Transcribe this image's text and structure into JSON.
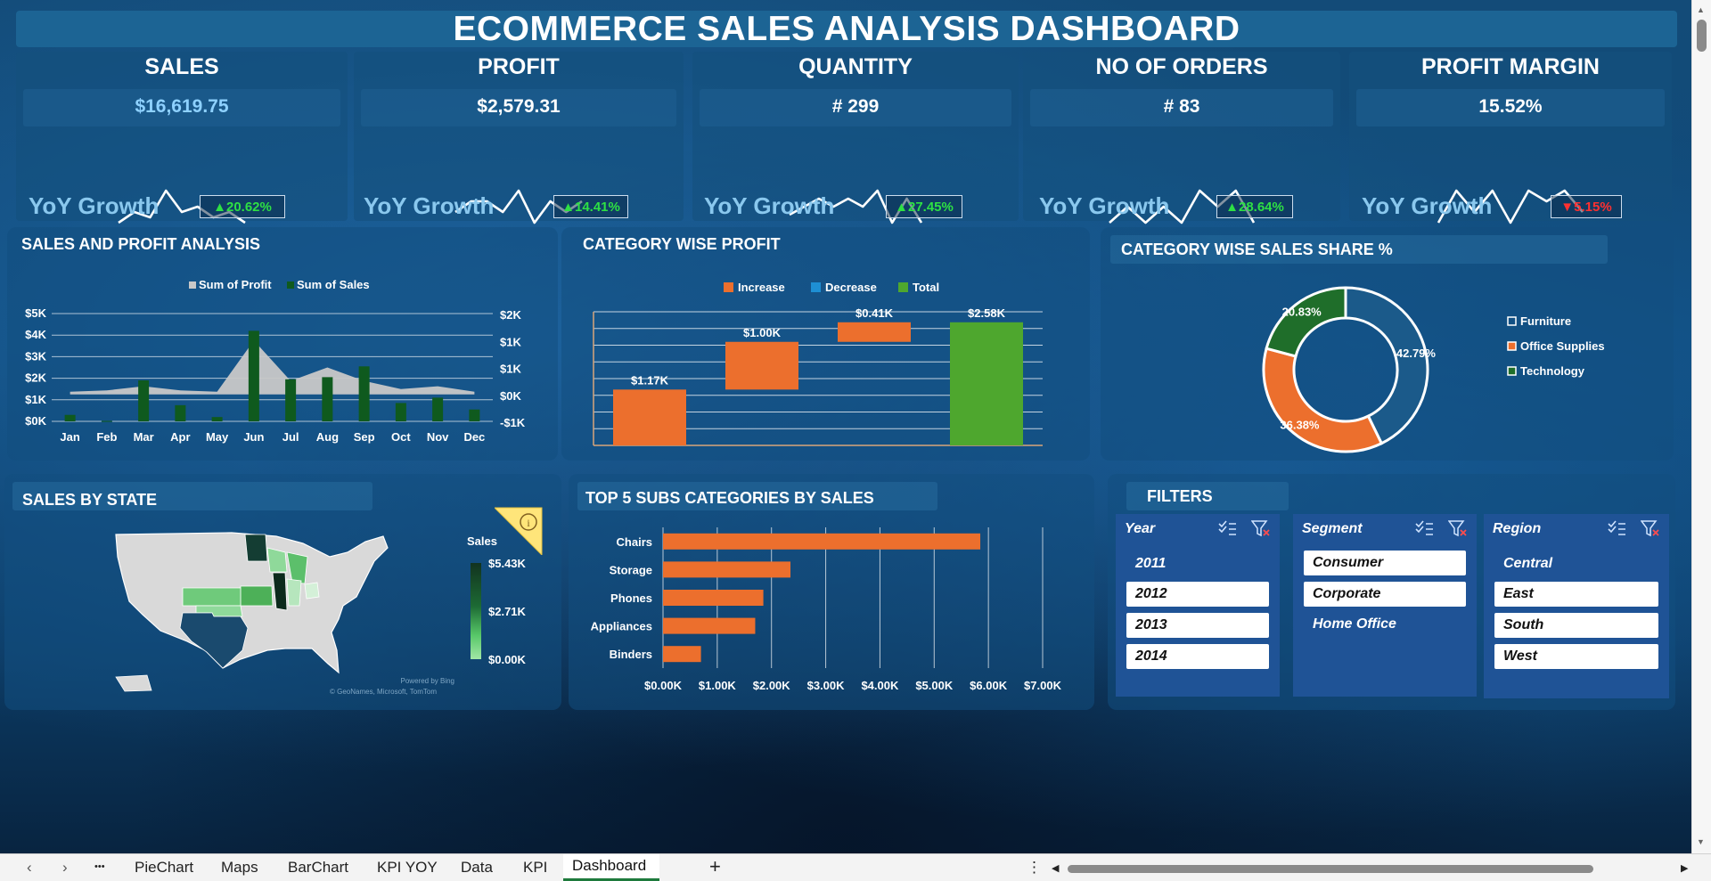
{
  "title": "ECOMMERCE SALES ANALYSIS DASHBOARD",
  "kpis": [
    {
      "title": "SALES",
      "value": "$16,619.75",
      "yoy_label": "YoY Growth",
      "yoy_value": "▲20.62%",
      "trend": "up",
      "spark": [
        3,
        5,
        4,
        9,
        5,
        6,
        4,
        5,
        3
      ]
    },
    {
      "title": "PROFIT",
      "value": "$2,579.31",
      "yoy_label": "YoY Growth",
      "yoy_value": "▲14.41%",
      "trend": "up",
      "spark": [
        4,
        5,
        5,
        4,
        6,
        3,
        5,
        4,
        5
      ]
    },
    {
      "title": "QUANTITY",
      "value": "# 299",
      "yoy_label": "YoY Growth",
      "yoy_value": "▲27.45%",
      "trend": "up",
      "spark": [
        3,
        4,
        5,
        4,
        5,
        4,
        6,
        2,
        5,
        2
      ]
    },
    {
      "title": "NO OF ORDERS",
      "value": "# 83",
      "yoy_label": "YoY Growth",
      "yoy_value": "▲28.64%",
      "trend": "up",
      "spark": [
        3,
        4,
        3,
        4,
        3,
        5,
        4,
        5,
        3
      ]
    },
    {
      "title": "PROFIT MARGIN",
      "value": "15.52%",
      "yoy_label": "YoY Growth",
      "yoy_value": "▼5.15%",
      "trend": "down",
      "spark": [
        3,
        6,
        4,
        6,
        3,
        6,
        5,
        6,
        4
      ]
    }
  ],
  "sections": {
    "sales_profit": "SALES AND PROFIT ANALYSIS",
    "category_profit": "CATEGORY WISE PROFIT",
    "category_share": "CATEGORY WISE SALES SHARE %",
    "sales_state": "SALES  BY STATE",
    "top5": "TOP 5 SUBS CATEGORIES BY SALES",
    "filters": "FILTERS"
  },
  "chart_data": [
    {
      "type": "bar",
      "title": "SALES AND PROFIT ANALYSIS",
      "categories": [
        "Jan",
        "Feb",
        "Mar",
        "Apr",
        "May",
        "Jun",
        "Jul",
        "Aug",
        "Sep",
        "Oct",
        "Nov",
        "Dec"
      ],
      "series": [
        {
          "name": "Sum of Profit",
          "kind": "area",
          "axis": "right",
          "values": [
            0.1,
            0.15,
            0.3,
            0.15,
            0.1,
            2.0,
            0.5,
            1.0,
            0.5,
            0.2,
            0.3,
            0.1
          ],
          "color": "#c8c8c8"
        },
        {
          "name": "Sum of Sales",
          "kind": "column",
          "axis": "left",
          "values": [
            0.3,
            0.02,
            1.9,
            0.75,
            0.2,
            4.2,
            1.95,
            2.05,
            2.55,
            0.85,
            1.1,
            0.55
          ],
          "color": "#0f5a1e"
        }
      ],
      "left_ticks": [
        "$0K",
        "$1K",
        "$2K",
        "$3K",
        "$4K",
        "$5K"
      ],
      "right_ticks": [
        "-$1K",
        "$0K",
        "$1K",
        "$1K",
        "$2K"
      ],
      "ylim_left": [
        0,
        5
      ],
      "ylim_right": [
        -1,
        3
      ],
      "legend": "top"
    },
    {
      "type": "bar",
      "title": "CATEGORY WISE PROFIT",
      "waterfall": [
        {
          "label": "$1.17K",
          "start": 0,
          "end": 1.17,
          "kind": "Increase"
        },
        {
          "label": "$1.00K",
          "start": 1.17,
          "end": 2.17,
          "kind": "Increase"
        },
        {
          "label": "$0.41K",
          "start": 2.17,
          "end": 2.58,
          "kind": "Increase"
        },
        {
          "label": "$2.58K",
          "start": 0,
          "end": 2.58,
          "kind": "Total"
        }
      ],
      "legend_items": [
        {
          "name": "Increase",
          "color": "#ec6f2d"
        },
        {
          "name": "Decrease",
          "color": "#1e8fd4"
        },
        {
          "name": "Total",
          "color": "#4ea72e"
        }
      ],
      "ylim": [
        0,
        2.8
      ]
    },
    {
      "type": "pie",
      "title": "CATEGORY WISE SALES SHARE %",
      "donut": true,
      "slices": [
        {
          "name": "Furniture",
          "value": 42.79,
          "label": "42.79%",
          "color": "#1b5a8a"
        },
        {
          "name": "Office Supplies",
          "value": 36.38,
          "label": "36.38%",
          "color": "#ec6f2d"
        },
        {
          "name": "Technology",
          "value": 20.83,
          "label": "20.83%",
          "color": "#1f6e2a"
        }
      ],
      "legend": "right"
    },
    {
      "type": "bar",
      "orientation": "horizontal",
      "title": "TOP 5 SUBS CATEGORIES BY SALES",
      "categories": [
        "Chairs",
        "Storage",
        "Phones",
        "Appliances",
        "Binders"
      ],
      "values": [
        5.85,
        2.35,
        1.85,
        1.7,
        0.7
      ],
      "x_ticks": [
        "$0.00K",
        "$1.00K",
        "$2.00K",
        "$3.00K",
        "$4.00K",
        "$5.00K",
        "$6.00K",
        "$7.00K"
      ],
      "xlim": [
        0,
        7
      ],
      "color": "#ec6f2d"
    }
  ],
  "map": {
    "legend_title": "Sales",
    "legend_max": "$5.43K",
    "legend_mid": "$2.71K",
    "legend_min": "$0.00K",
    "attribution_1": "Powered by Bing",
    "attribution_2": "© GeoNames, Microsoft, TomTom",
    "info_icon": "info-icon"
  },
  "filters": {
    "year": {
      "title": "Year",
      "items": [
        {
          "label": "2011",
          "selected": false
        },
        {
          "label": "2012",
          "selected": true
        },
        {
          "label": "2013",
          "selected": true
        },
        {
          "label": "2014",
          "selected": true
        }
      ]
    },
    "segment": {
      "title": "Segment",
      "items": [
        {
          "label": "Consumer",
          "selected": true
        },
        {
          "label": "Corporate",
          "selected": true
        },
        {
          "label": "Home Office",
          "selected": false
        }
      ]
    },
    "region": {
      "title": "Region",
      "items": [
        {
          "label": "Central",
          "selected": false
        },
        {
          "label": "East",
          "selected": true
        },
        {
          "label": "South",
          "selected": true
        },
        {
          "label": "West",
          "selected": true
        }
      ]
    }
  },
  "sheet_tabs": [
    "PieChart",
    "Maps",
    "BarChart",
    "KPI YOY",
    "Data",
    "KPI",
    "Dashboard"
  ],
  "active_tab": "Dashboard",
  "tabbar_glyphs": {
    "prev": "‹",
    "next": "›",
    "more": "•••",
    "add": "+",
    "menu": "⋮",
    "scroll_left": "◀",
    "scroll_right": "▶"
  },
  "colors": {
    "orange": "#ec6f2d",
    "green": "#4ea72e",
    "dark_green": "#0f5a1e",
    "navy": "#1b5a8a",
    "up": "#2ee044",
    "down": "#ff3030"
  }
}
